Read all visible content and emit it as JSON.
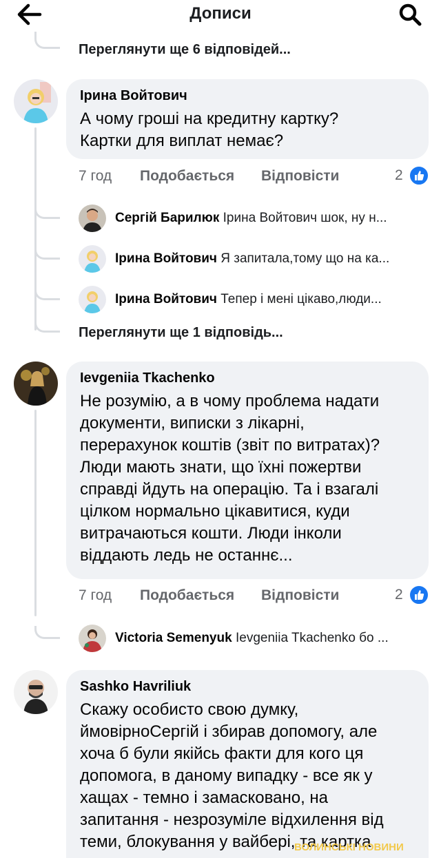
{
  "header": {
    "title": "Дописи",
    "back_icon": "arrow-left-icon",
    "search_icon": "search-icon"
  },
  "thread0": {
    "more_replies": "Переглянути ще 6 відповідей..."
  },
  "comments": [
    {
      "author": "Ірина Войтович",
      "lines": [
        "А чому гроші на кредитну картку?",
        "Картки для виплат немає?"
      ],
      "time": "7 год",
      "like": "Подобається",
      "reply": "Відповісти",
      "reactions": "2",
      "replies": [
        {
          "name": "Сергій Барилюк",
          "text": "Ірина Войтович шок, ну н..."
        },
        {
          "name": "Ірина Войтович",
          "text": "Я запитала,тому що на ка..."
        },
        {
          "name": "Ірина Войтович",
          "text": "Тепер і мені цікаво,люди..."
        }
      ],
      "more_replies": "Переглянути ще 1 відповідь..."
    },
    {
      "author": "Ievgeniia Tkachenko",
      "lines": [
        "Не розумію, а в чому проблема надати",
        "документи, виписки з лікарні,",
        "перерахунок коштів (звіт по витратах)?",
        "Люди мають знати, що їхні пожертви",
        "справді йдуть на операцію. Та і взагалі",
        "цілком нормально цікавитися, куди",
        "витрачаються кошти. Люди інколи",
        "віддають ледь не останнє..."
      ],
      "time": "7 год",
      "like": "Подобається",
      "reply": "Відповісти",
      "reactions": "2",
      "replies": [
        {
          "name": "Victoria Semenyuk",
          "text": "Ievgeniia Tkachenko бо ..."
        }
      ]
    },
    {
      "author": "Sashko Havriliuk",
      "lines": [
        "Скажу особисто свою думку,",
        "ймовірноСергій і збирав допомогу, але",
        "хоча б були якійсь факти для кого ця",
        "допомога, в даному випадку - все як у",
        "хащах - темно і замасковано, на",
        "запитання - незрозуміле відхилення від",
        "теми, блокування у вайбері, та картка"
      ]
    }
  ],
  "watermark": "ВОЛИНСЬКІ НОВИНИ",
  "colors": {
    "like_blue": "#1877f2",
    "bubble": "#f0f2f5",
    "meta_gray": "#65676b"
  }
}
